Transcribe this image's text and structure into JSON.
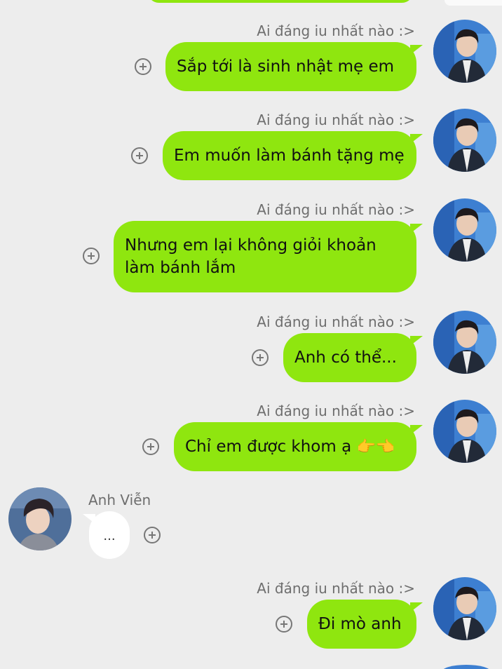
{
  "chat": {
    "self_name": "Ai đáng iu nhất nào :>",
    "other_name": "Anh Viễn",
    "colors": {
      "background": "#ededed",
      "self_bubble": "#8fe60f",
      "other_bubble": "#ffffff",
      "name_text": "#6e6e6e"
    },
    "messages": [
      {
        "sender": "Ai đáng iu nhất nào :>",
        "text": "Sắp tới là sinh nhật mẹ em"
      },
      {
        "sender": "Ai đáng iu nhất nào :>",
        "text": "Em muốn làm bánh tặng mẹ"
      },
      {
        "sender": "Ai đáng iu nhất nào :>",
        "text": "Nhưng em lại không giỏi khoản làm bánh lắm"
      },
      {
        "sender": "Ai đáng iu nhất nào :>",
        "text": "Anh có thể..."
      },
      {
        "sender": "Ai đáng iu nhất nào :>",
        "text": "Chỉ em được khom ạ",
        "emoji": "👉👈"
      },
      {
        "sender": "Anh Viễn",
        "text": "..."
      },
      {
        "sender": "Ai đáng iu nhất nào :>",
        "text": "Đi mò anh"
      }
    ]
  }
}
